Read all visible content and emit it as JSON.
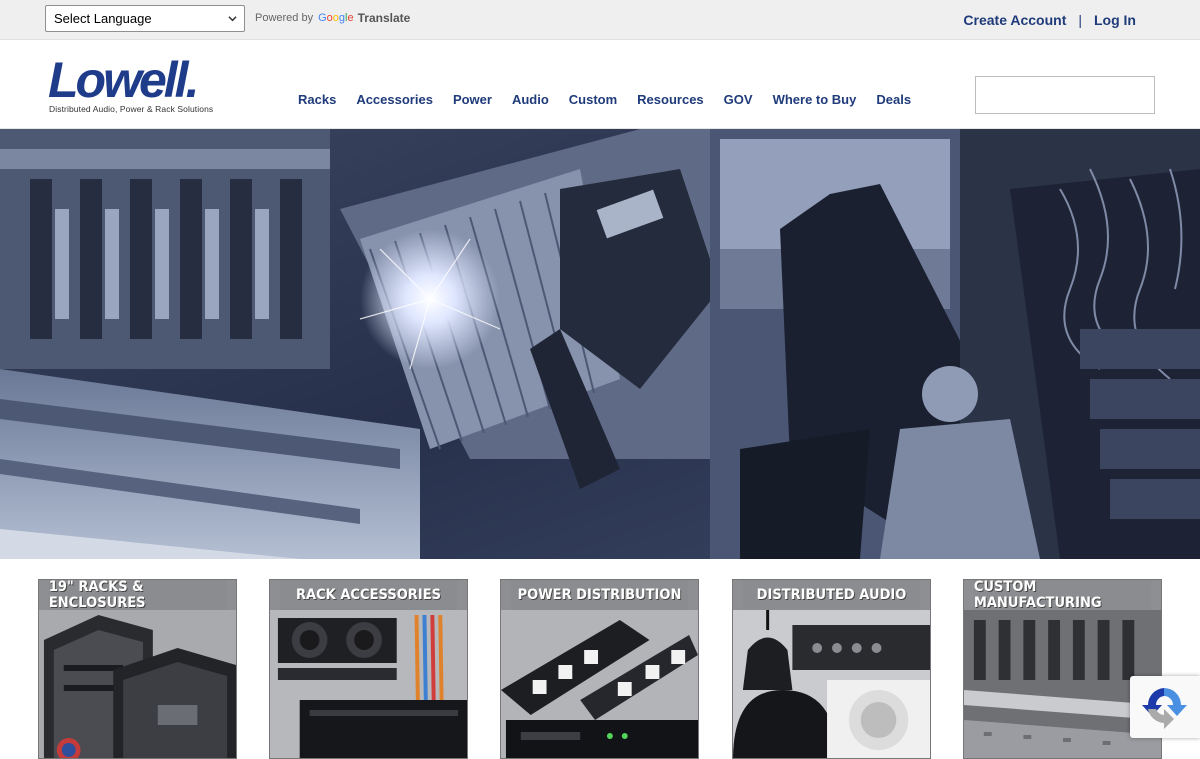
{
  "language_select": {
    "selected": "Select Language"
  },
  "translate": {
    "powered_by": "Powered by",
    "google": "Google",
    "translate": "Translate"
  },
  "account": {
    "create": "Create Account",
    "separator": "|",
    "login": "Log In"
  },
  "logo": {
    "name": "Lowell.",
    "tagline": "Distributed Audio, Power & Rack Solutions"
  },
  "nav": {
    "items": [
      {
        "label": "Racks"
      },
      {
        "label": "Accessories"
      },
      {
        "label": "Power"
      },
      {
        "label": "Audio"
      },
      {
        "label": "Custom"
      },
      {
        "label": "Resources"
      },
      {
        "label": "GOV"
      },
      {
        "label": "Where to Buy"
      },
      {
        "label": "Deals"
      }
    ]
  },
  "search": {
    "placeholder": ""
  },
  "categories": [
    {
      "label": "19\" RACKS & ENCLOSURES"
    },
    {
      "label": "RACK ACCESSORIES"
    },
    {
      "label": "POWER DISTRIBUTION"
    },
    {
      "label": "DISTRIBUTED AUDIO"
    },
    {
      "label": "CUSTOM MANUFACTURING"
    }
  ],
  "colors": {
    "brand": "#1f3c8a",
    "link": "#1f3b7a",
    "tile_header": "#8b8c8f"
  }
}
